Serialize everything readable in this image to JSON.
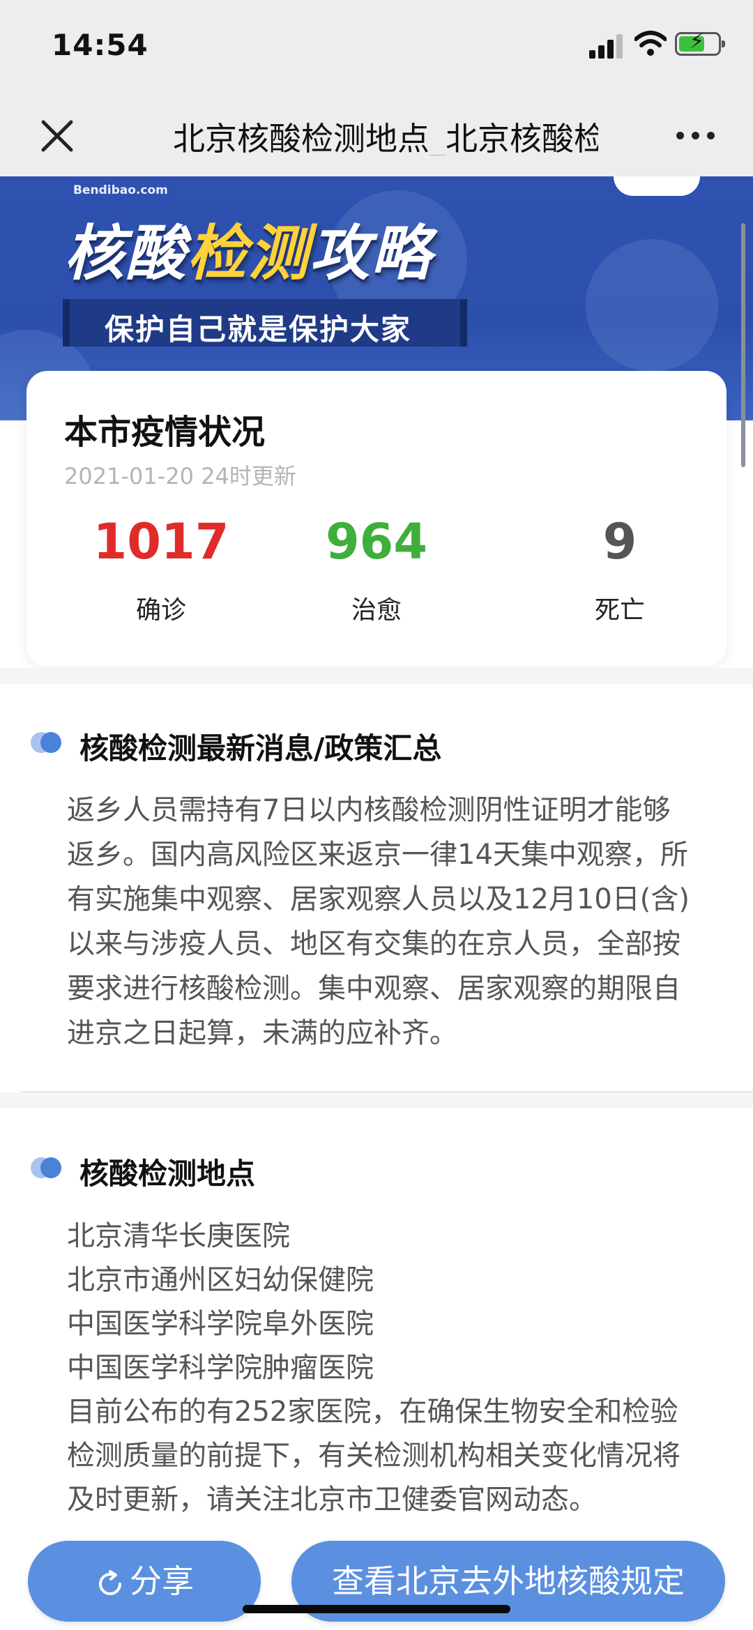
{
  "status_bar": {
    "time": "14:54"
  },
  "nav": {
    "title": "北京核酸检测地点_北京核酸检测机构",
    "close_icon": "close-icon",
    "more_icon": "more-dots-icon"
  },
  "banner": {
    "site": "Bendibao.com",
    "title_pre": "核酸",
    "title_highlight": "检测",
    "title_post": "攻略",
    "subtitle": "保护自己就是保护大家",
    "colors": {
      "background": "#2f52b0",
      "highlight": "#ffd23a"
    }
  },
  "stats": {
    "title": "本市疫情状况",
    "updated": "2021-01-20 24时更新",
    "items": [
      {
        "value": "1017",
        "label": "确诊",
        "color": "#e02b2b"
      },
      {
        "value": "964",
        "label": "治愈",
        "color": "#3fae3a"
      },
      {
        "value": "9",
        "label": "死亡",
        "color": "#555555"
      }
    ]
  },
  "news": {
    "title": "核酸检测最新消息/政策汇总",
    "lines": [
      "返乡人员需持有7日以内核酸检测阴性证明才能够",
      "返乡。国内高风险区来返京一律14天集中观察，所",
      "有实施集中观察、居家观察人员以及12月10日(含)",
      "以来与涉疫人员、地区有交集的在京人员，全部按",
      "要求进行核酸检测。集中观察、居家观察的期限自",
      "进京之日起算，未满的应补齐。"
    ]
  },
  "locations": {
    "title": "核酸检测地点",
    "items": [
      "北京清华长庚医院",
      "北京市通州区妇幼保健院",
      "中国医学科学院阜外医院",
      "中国医学科学院肿瘤医院"
    ],
    "note_lines": [
      "目前公布的有252家医院，在确保生物安全和检验",
      "检测质量的前提下，有关检测机构相关变化情况将",
      "及时更新，请关注北京市卫健委官网动态。"
    ]
  },
  "actions": {
    "share_label": "分享",
    "rule_label": "查看北京去外地核酸规定",
    "button_color": "#5b8fe0"
  }
}
